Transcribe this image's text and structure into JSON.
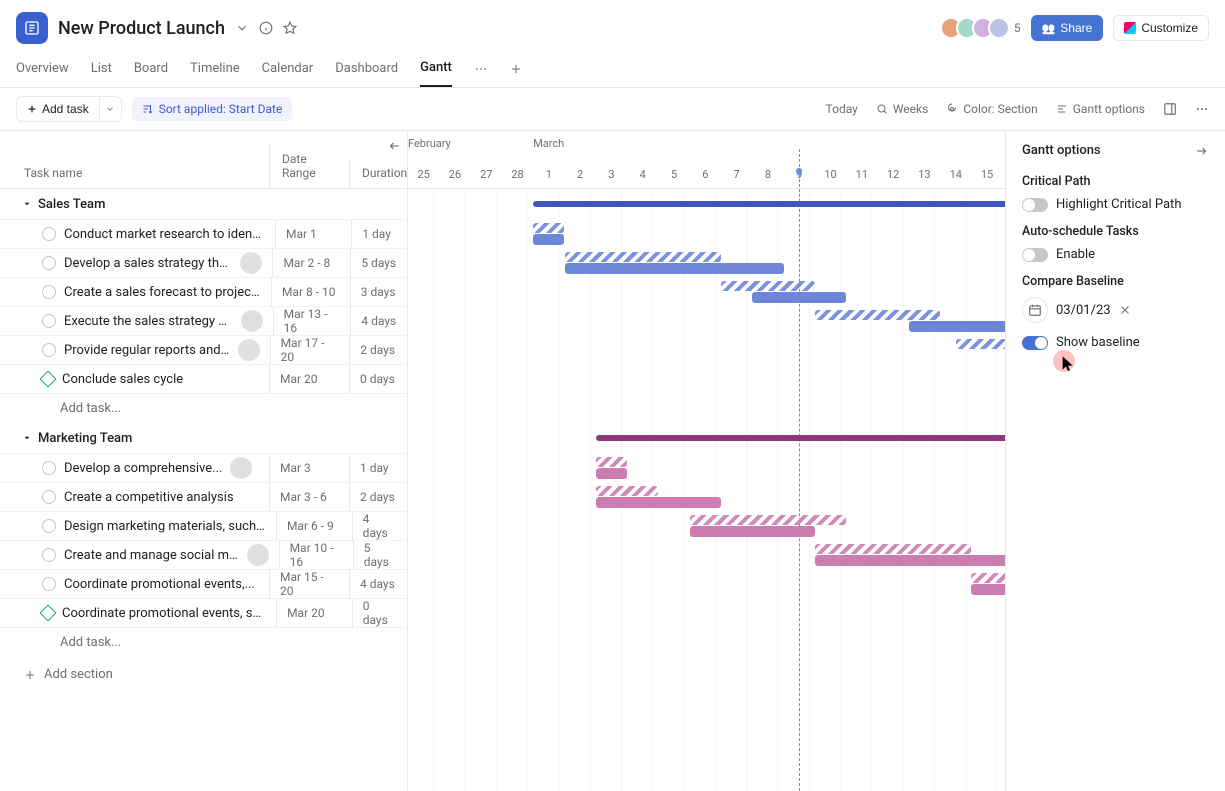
{
  "header": {
    "project_title": "New Product Launch",
    "members_count": "5",
    "share_label": "Share",
    "customize_label": "Customize"
  },
  "tabs": {
    "items": [
      "Overview",
      "List",
      "Board",
      "Timeline",
      "Calendar",
      "Dashboard",
      "Gantt"
    ],
    "active": "Gantt"
  },
  "toolbar": {
    "add_task": "Add task",
    "sort_label": "Sort applied: Start Date",
    "today": "Today",
    "weeks": "Weeks",
    "color": "Color: Section",
    "gantt_options": "Gantt options"
  },
  "columns": {
    "task": "Task name",
    "date": "Date Range",
    "duration": "Duration"
  },
  "sections": [
    {
      "name": "Sales Team",
      "section_start_day": 4,
      "section_span_days": 20,
      "color_class": "sales",
      "add_text": "Add task...",
      "tasks": [
        {
          "name": "Conduct market research to identify...",
          "date": "Mar 1",
          "duration": "1 day",
          "has_avatar": false,
          "milestone": false,
          "bl_start": 4,
          "bl_span": 1,
          "ab_start": 4,
          "ab_span": 1
        },
        {
          "name": "Develop a sales strategy that...",
          "date": "Mar 2 - 8",
          "duration": "5 days",
          "has_avatar": true,
          "milestone": false,
          "bl_start": 5,
          "bl_span": 5,
          "ab_start": 5,
          "ab_span": 7
        },
        {
          "name": "Create a sales forecast to project...",
          "date": "Mar 8 - 10",
          "duration": "3 days",
          "has_avatar": false,
          "milestone": false,
          "bl_start": 10,
          "bl_span": 3,
          "ab_start": 11,
          "ab_span": 3
        },
        {
          "name": "Execute the sales strategy by...",
          "date": "Mar 13 - 16",
          "duration": "4 days",
          "has_avatar": true,
          "milestone": false,
          "bl_start": 13,
          "bl_span": 4,
          "ab_start": 16,
          "ab_span": 4
        },
        {
          "name": "Provide regular reports and...",
          "date": "Mar 17 - 20",
          "duration": "2 days",
          "has_avatar": true,
          "milestone": false,
          "bl_start": 17.5,
          "bl_span": 4,
          "ab_start": 20,
          "ab_span": 3
        },
        {
          "name": "Conclude sales cycle",
          "date": "Mar 20",
          "duration": "0 days",
          "has_avatar": false,
          "milestone": true
        }
      ]
    },
    {
      "name": "Marketing Team",
      "section_start_day": 6,
      "section_span_days": 18,
      "color_class": "mkt",
      "add_text": "Add task...",
      "tasks": [
        {
          "name": "Develop a comprehensive...",
          "date": "Mar 3",
          "duration": "1 day",
          "has_avatar": true,
          "milestone": false,
          "bl_start": 6,
          "bl_span": 1,
          "ab_start": 6,
          "ab_span": 1
        },
        {
          "name": "Create a competitive analysis",
          "date": "Mar 3 - 6",
          "duration": "2 days",
          "has_avatar": false,
          "milestone": false,
          "bl_start": 6,
          "bl_span": 2,
          "ab_start": 6,
          "ab_span": 4
        },
        {
          "name": "Design marketing materials, such as...",
          "date": "Mar 6 - 9",
          "duration": "4 days",
          "has_avatar": false,
          "milestone": false,
          "bl_start": 9,
          "bl_span": 5,
          "ab_start": 9,
          "ab_span": 4
        },
        {
          "name": "Create and manage social media...",
          "date": "Mar 10 - 16",
          "duration": "5 days",
          "has_avatar": true,
          "milestone": false,
          "bl_start": 13,
          "bl_span": 5,
          "ab_start": 13,
          "ab_span": 7
        },
        {
          "name": "Coordinate promotional events,...",
          "date": "Mar 15 - 20",
          "duration": "4 days",
          "has_avatar": false,
          "milestone": false,
          "bl_start": 18,
          "bl_span": 5,
          "ab_start": 18,
          "ab_span": 6
        },
        {
          "name": "Coordinate promotional events, such...",
          "date": "Mar 20",
          "duration": "0 days",
          "has_avatar": false,
          "milestone": true
        }
      ]
    }
  ],
  "add_section": "Add section",
  "timeline": {
    "months": [
      {
        "label": "February",
        "at_day": 0
      },
      {
        "label": "March",
        "at_day": 4
      }
    ],
    "days": [
      "25",
      "26",
      "27",
      "28",
      "1",
      "2",
      "3",
      "4",
      "5",
      "6",
      "7",
      "8",
      "9",
      "10",
      "11",
      "12",
      "13",
      "14",
      "15"
    ],
    "today_index": 12
  },
  "panel": {
    "title": "Gantt options",
    "critical_path_label": "Critical Path",
    "highlight_cp": "Highlight Critical Path",
    "auto_schedule_label": "Auto-schedule Tasks",
    "enable": "Enable",
    "compare_label": "Compare Baseline",
    "baseline_date": "03/01/23",
    "show_baseline": "Show baseline",
    "toggles": {
      "critical_path": false,
      "auto_schedule": false,
      "show_baseline": true
    }
  }
}
